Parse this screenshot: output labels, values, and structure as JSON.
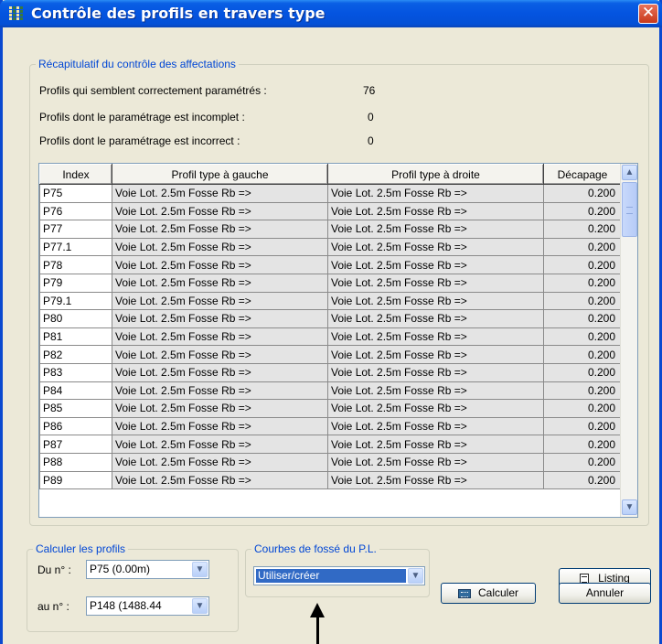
{
  "window": {
    "title": "Contrôle des profils en travers type",
    "close_glyph": "✕"
  },
  "summary": {
    "legend": "Récapitulatif du contrôle des affectations",
    "rows": [
      {
        "label": "Profils qui semblent correctement paramétrés :",
        "value": "76"
      },
      {
        "label": "Profils dont le paramétrage est incomplet   :",
        "value": "0"
      },
      {
        "label": "Profils dont le paramétrage est incorrect   :",
        "value": "0"
      }
    ]
  },
  "table": {
    "columns": [
      "Index",
      "Profil type à gauche",
      "Profil type à droite",
      "Décapage"
    ],
    "rows": [
      [
        "P75",
        "Voie Lot. 2.5m Fosse Rb =>",
        "Voie Lot. 2.5m Fosse Rb =>",
        "0.200"
      ],
      [
        "P76",
        "Voie Lot. 2.5m Fosse Rb =>",
        "Voie Lot. 2.5m Fosse Rb =>",
        "0.200"
      ],
      [
        "P77",
        "Voie Lot. 2.5m Fosse Rb =>",
        "Voie Lot. 2.5m Fosse Rb =>",
        "0.200"
      ],
      [
        "P77.1",
        "Voie Lot. 2.5m Fosse Rb =>",
        "Voie Lot. 2.5m Fosse Rb =>",
        "0.200"
      ],
      [
        "P78",
        "Voie Lot. 2.5m Fosse Rb =>",
        "Voie Lot. 2.5m Fosse Rb =>",
        "0.200"
      ],
      [
        "P79",
        "Voie Lot. 2.5m Fosse Rb =>",
        "Voie Lot. 2.5m Fosse Rb =>",
        "0.200"
      ],
      [
        "P79.1",
        "Voie Lot. 2.5m Fosse Rb =>",
        "Voie Lot. 2.5m Fosse Rb =>",
        "0.200"
      ],
      [
        "P80",
        "Voie Lot. 2.5m Fosse Rb =>",
        "Voie Lot. 2.5m Fosse Rb =>",
        "0.200"
      ],
      [
        "P81",
        "Voie Lot. 2.5m Fosse Rb =>",
        "Voie Lot. 2.5m Fosse Rb =>",
        "0.200"
      ],
      [
        "P82",
        "Voie Lot. 2.5m Fosse Rb =>",
        "Voie Lot. 2.5m Fosse Rb =>",
        "0.200"
      ],
      [
        "P83",
        "Voie Lot. 2.5m Fosse Rb =>",
        "Voie Lot. 2.5m Fosse Rb =>",
        "0.200"
      ],
      [
        "P84",
        "Voie Lot. 2.5m Fosse Rb =>",
        "Voie Lot. 2.5m Fosse Rb =>",
        "0.200"
      ],
      [
        "P85",
        "Voie Lot. 2.5m Fosse Rb =>",
        "Voie Lot. 2.5m Fosse Rb =>",
        "0.200"
      ],
      [
        "P86",
        "Voie Lot. 2.5m Fosse Rb =>",
        "Voie Lot. 2.5m Fosse Rb =>",
        "0.200"
      ],
      [
        "P87",
        "Voie Lot. 2.5m Fosse Rb =>",
        "Voie Lot. 2.5m Fosse Rb =>",
        "0.200"
      ],
      [
        "P88",
        "Voie Lot. 2.5m Fosse Rb =>",
        "Voie Lot. 2.5m Fosse Rb =>",
        "0.200"
      ],
      [
        "P89",
        "Voie Lot. 2.5m Fosse Rb =>",
        "Voie Lot. 2.5m Fosse Rb =>",
        "0.200"
      ]
    ],
    "scroll_up_glyph": "▲",
    "scroll_down_glyph": "▼"
  },
  "calc_group": {
    "legend": "Calculer les profils",
    "from_label": "Du n° :",
    "from_value": "P75 (0.00m)",
    "to_label": "au n° :",
    "to_value": "P148 (1488.44"
  },
  "ditch_group": {
    "legend": "Courbes de fossé du P.L.",
    "value": "Utiliser/créer"
  },
  "buttons": {
    "listing": "Listing",
    "calculer": "Calculer",
    "annuler": "Annuler"
  },
  "combo_glyph": "▼",
  "colors": {
    "title_blue": "#0454e0",
    "legend_blue": "#0046d5",
    "selection": "#316ac5"
  }
}
